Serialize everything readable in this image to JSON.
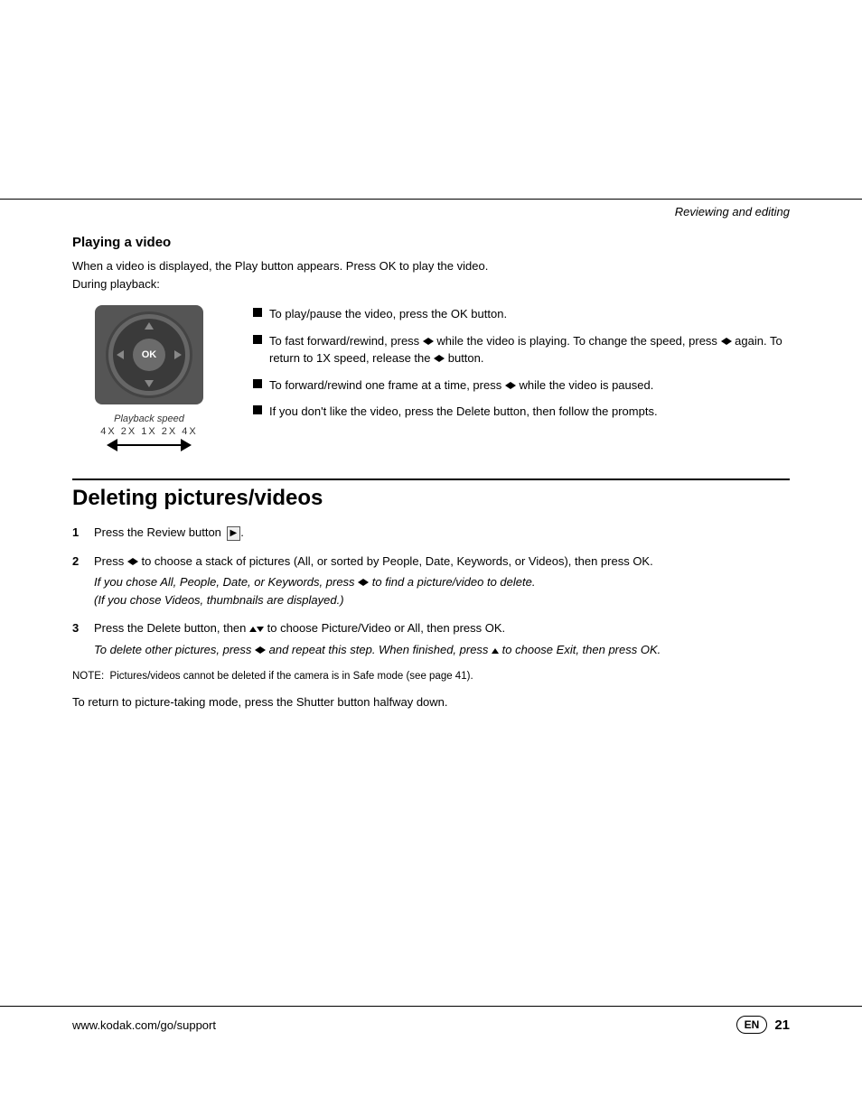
{
  "page": {
    "section_header": "Reviewing and editing",
    "footer_url": "www.kodak.com/go/support",
    "footer_lang": "EN",
    "footer_page": "21"
  },
  "playing_video": {
    "title": "Playing a video",
    "intro": "When a video is displayed, the Play button appears. Press OK to play the video.\nDuring playback:",
    "playback_caption": "Playback speed",
    "playback_speeds": "4X  2X  1X  2X  4X",
    "bullets": [
      {
        "id": 1,
        "text": "To play/pause the video, press the OK button."
      },
      {
        "id": 2,
        "text": "To fast forward/rewind, press ◀▶ while the video is playing. To change the speed, press ◀▶ again. To return to 1X speed, release the ◀▶ button."
      },
      {
        "id": 3,
        "text": "To forward/rewind one frame at a time, press ◀▶ while the video is paused."
      },
      {
        "id": 4,
        "text": "If you don't like the video, press the Delete button, then follow the prompts."
      }
    ]
  },
  "deleting": {
    "title": "Deleting pictures/videos",
    "steps": [
      {
        "num": "1",
        "text": "Press the Review button",
        "italic": ""
      },
      {
        "num": "2",
        "text": "Press ◀▶ to choose a stack of pictures (All, or sorted by People, Date, Keywords, or Videos), then press OK.",
        "italic": "If you chose All, People, Date, or Keywords, press ◀▶ to find a picture/video to delete.\n(If you chose Videos, thumbnails are displayed.)"
      },
      {
        "num": "3",
        "text": "Press the Delete button, then ▲▼ to choose Picture/Video or All, then press OK.",
        "italic": "To delete other pictures, press ◀▶ and repeat this step. When finished, press ▲ to choose Exit, then press OK."
      }
    ],
    "note": "NOTE:  Pictures/videos cannot be deleted if the camera is in Safe mode (see page 41).",
    "return_text": "To return to picture-taking mode, press the Shutter button halfway down."
  }
}
